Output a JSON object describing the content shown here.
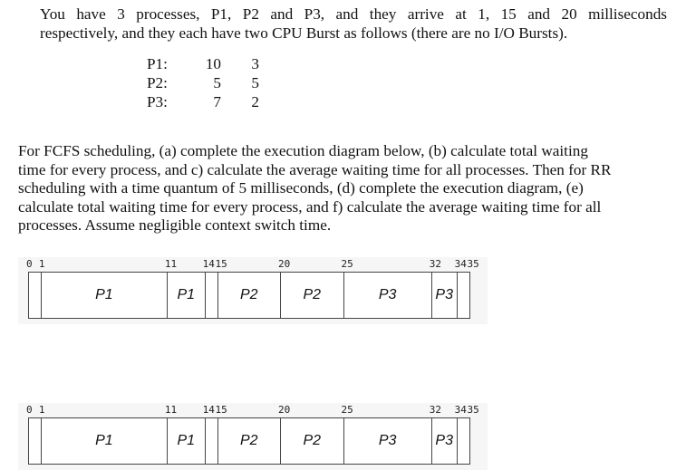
{
  "question": {
    "intro_lines": [
      "You have 3 processes, P1, P2 and P3, and they arrive at 1, 15 and 20 milliseconds",
      "respectively, and they each have two CPU Burst as follows (there are no I/O Bursts)."
    ],
    "bursts": [
      {
        "name": "P1:",
        "burst1": "10",
        "burst2": "3"
      },
      {
        "name": "P2:",
        "burst1": "5",
        "burst2": "5"
      },
      {
        "name": "P3:",
        "burst1": "7",
        "burst2": "2"
      }
    ],
    "instructions_lines": [
      "For FCFS scheduling, (a) complete the execution diagram below, (b) calculate total waiting",
      "time for every process, and c) calculate the average waiting time for all processes. Then for RR",
      "scheduling with a time quantum of 5 milliseconds, (d) complete the execution diagram, (e)",
      "calculate total waiting time for every process, and f) calculate the average waiting time for all",
      "processes. Assume negligible context switch time."
    ]
  },
  "diagrams": [
    {
      "name": "fcfs-diagram",
      "ticks": [
        {
          "t": 0,
          "label": "0"
        },
        {
          "t": 1,
          "label": "1"
        },
        {
          "t": 11,
          "label": "11"
        },
        {
          "t": 14,
          "label": "14"
        },
        {
          "t": 15,
          "label": "15"
        },
        {
          "t": 20,
          "label": "20"
        },
        {
          "t": 25,
          "label": "25"
        },
        {
          "t": 32,
          "label": "32"
        },
        {
          "t": 34,
          "label": "34"
        },
        {
          "t": 35,
          "label": "35"
        }
      ],
      "segments": [
        {
          "start": 0,
          "end": 1,
          "label": ""
        },
        {
          "start": 1,
          "end": 11,
          "label": "P1"
        },
        {
          "start": 11,
          "end": 14,
          "label": "P1"
        },
        {
          "start": 14,
          "end": 15,
          "label": ""
        },
        {
          "start": 15,
          "end": 20,
          "label": "P2"
        },
        {
          "start": 20,
          "end": 25,
          "label": "P2"
        },
        {
          "start": 25,
          "end": 32,
          "label": "P3"
        },
        {
          "start": 32,
          "end": 34,
          "label": "P3"
        },
        {
          "start": 34,
          "end": 35,
          "label": ""
        }
      ]
    },
    {
      "name": "rr-diagram",
      "ticks": [
        {
          "t": 0,
          "label": "0"
        },
        {
          "t": 1,
          "label": "1"
        },
        {
          "t": 11,
          "label": "11"
        },
        {
          "t": 14,
          "label": "14"
        },
        {
          "t": 15,
          "label": "15"
        },
        {
          "t": 20,
          "label": "20"
        },
        {
          "t": 25,
          "label": "25"
        },
        {
          "t": 32,
          "label": "32"
        },
        {
          "t": 34,
          "label": "34"
        },
        {
          "t": 35,
          "label": "35"
        }
      ],
      "segments": [
        {
          "start": 0,
          "end": 1,
          "label": ""
        },
        {
          "start": 1,
          "end": 11,
          "label": "P1"
        },
        {
          "start": 11,
          "end": 14,
          "label": "P1"
        },
        {
          "start": 14,
          "end": 15,
          "label": ""
        },
        {
          "start": 15,
          "end": 20,
          "label": "P2"
        },
        {
          "start": 20,
          "end": 25,
          "label": "P2"
        },
        {
          "start": 25,
          "end": 32,
          "label": "P3"
        },
        {
          "start": 32,
          "end": 34,
          "label": "P3"
        },
        {
          "start": 34,
          "end": 35,
          "label": ""
        }
      ]
    }
  ]
}
